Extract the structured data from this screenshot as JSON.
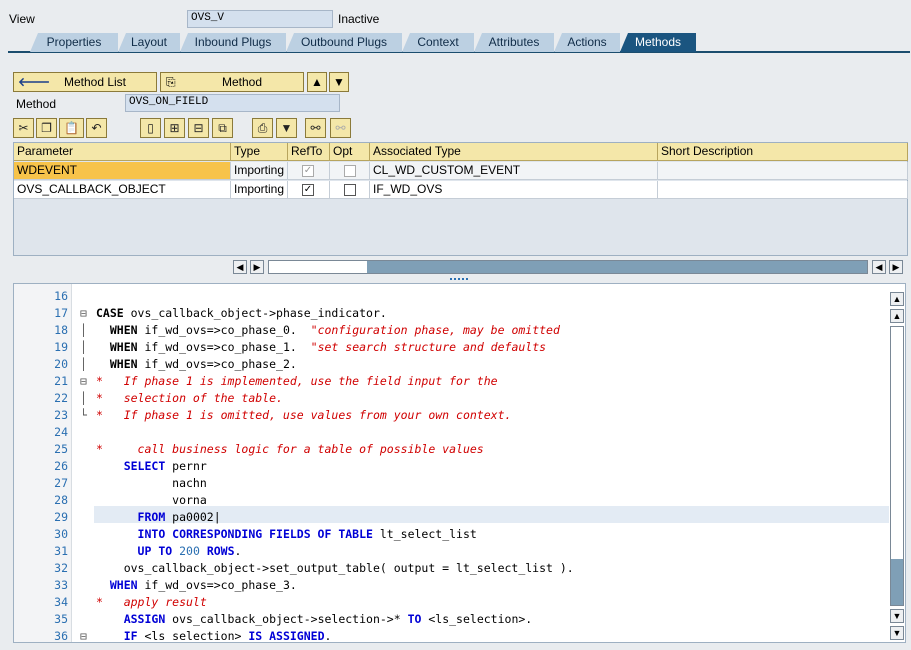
{
  "view": {
    "label": "View",
    "value": "OVS_V",
    "status": "Inactive"
  },
  "tabs": [
    "Properties",
    "Layout",
    "Inbound Plugs",
    "Outbound Plugs",
    "Context",
    "Attributes",
    "Actions",
    "Methods"
  ],
  "method_bar": {
    "back_label": "Method List",
    "method_label": "Method",
    "method_field_label": "Method",
    "method_value": "OVS_ON_FIELD"
  },
  "params": {
    "headers": [
      "Parameter",
      "Type",
      "RefTo",
      "Opt",
      "Associated Type",
      "Short Description"
    ],
    "rows": [
      {
        "name": "WDEVENT",
        "type": "Importing",
        "refto": true,
        "opt": false,
        "assoc": "CL_WD_CUSTOM_EVENT",
        "desc": ""
      },
      {
        "name": "OVS_CALLBACK_OBJECT",
        "type": "Importing",
        "refto": true,
        "opt": false,
        "assoc": "IF_WD_OVS",
        "desc": ""
      }
    ]
  },
  "code_lines": [
    {
      "n": "16",
      "fold": "",
      "html": ""
    },
    {
      "n": "17",
      "fold": "⊟",
      "html": "<span class='kb'>CASE</span> ovs_callback_object->phase_indicator."
    },
    {
      "n": "18",
      "fold": "│",
      "html": "  <span class='kb'>WHEN</span> if_wd_ovs=>co_phase_0.  <span class='cm'>\"configuration phase, may be omitted</span>"
    },
    {
      "n": "19",
      "fold": "│",
      "html": "  <span class='kb'>WHEN</span> if_wd_ovs=>co_phase_1.  <span class='cm'>\"set search structure and defaults</span>"
    },
    {
      "n": "20",
      "fold": "│",
      "html": "  <span class='kb'>WHEN</span> if_wd_ovs=>co_phase_2."
    },
    {
      "n": "21",
      "fold": "⊟",
      "html": "<span class='cm'>*   If phase 1 is implemented, use the field input for the</span>"
    },
    {
      "n": "22",
      "fold": "│",
      "html": "<span class='cm'>*   selection of the table.</span>"
    },
    {
      "n": "23",
      "fold": "└",
      "html": "<span class='cm'>*   If phase 1 is omitted, use values from your own context.</span>"
    },
    {
      "n": "24",
      "fold": "",
      "html": ""
    },
    {
      "n": "25",
      "fold": "",
      "html": "<span class='cm'>*     call business logic for a table of possible values</span>"
    },
    {
      "n": "26",
      "fold": "",
      "html": "    <span class='kw'>SELECT</span> pernr"
    },
    {
      "n": "27",
      "fold": "",
      "html": "           nachn"
    },
    {
      "n": "28",
      "fold": "",
      "html": "           vorna"
    },
    {
      "n": "29",
      "fold": "",
      "html": "      <span class='kw'>FROM</span> pa0002|"
    },
    {
      "n": "30",
      "fold": "",
      "html": "      <span class='kw'>INTO CORRESPONDING FIELDS OF TABLE</span> lt_select_list"
    },
    {
      "n": "31",
      "fold": "",
      "html": "      <span class='kw'>UP TO</span> <span class='num'>200</span> <span class='kw'>ROWS</span>."
    },
    {
      "n": "32",
      "fold": "",
      "html": "    ovs_callback_object->set_output_table( output = lt_select_list )."
    },
    {
      "n": "33",
      "fold": "",
      "html": "  <span class='kw'>WHEN</span> if_wd_ovs=>co_phase_3."
    },
    {
      "n": "34",
      "fold": "",
      "html": "<span class='cm'>*   apply result</span>"
    },
    {
      "n": "35",
      "fold": "",
      "html": "    <span class='kw'>ASSIGN</span> ovs_callback_object->selection->* <span class='kw'>TO</span> &lt;ls_selection&gt;."
    },
    {
      "n": "36",
      "fold": "⊟",
      "html": "    <span class='kw'>IF</span> &lt;ls_selection&gt; <span class='kw'>IS ASSIGNED</span>."
    }
  ],
  "colors": {
    "accent": "#1b5580",
    "button": "#f4e7a9",
    "selected_param": "#f7c34a"
  }
}
